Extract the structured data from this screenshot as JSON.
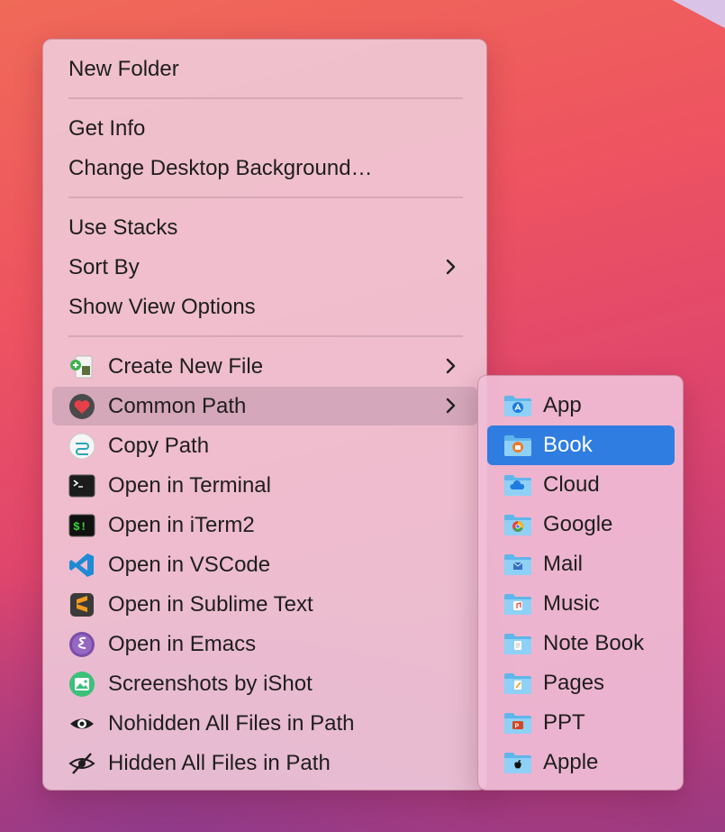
{
  "context_menu": {
    "group1": {
      "new_folder": "New Folder"
    },
    "group2": {
      "get_info": "Get Info",
      "change_bg": "Change Desktop Background…"
    },
    "group3": {
      "use_stacks": "Use Stacks",
      "sort_by": "Sort By",
      "show_view_options": "Show View Options"
    },
    "group4": {
      "create_new_file": "Create New File",
      "common_path": "Common Path",
      "copy_path": "Copy Path",
      "open_terminal": "Open in Terminal",
      "open_iterm2": "Open in iTerm2",
      "open_vscode": "Open in VSCode",
      "open_sublime": "Open in Sublime Text",
      "open_emacs": "Open in Emacs",
      "screenshots_ishot": "Screenshots by iShot",
      "nohidden_files": "Nohidden All Files in Path",
      "hidden_files": "Hidden All Files in Path"
    },
    "highlighted_item": "Common Path"
  },
  "submenu": {
    "items": [
      {
        "label": "App",
        "icon": "app-store-icon"
      },
      {
        "label": "Book",
        "icon": "books-icon"
      },
      {
        "label": "Cloud",
        "icon": "cloud-icon"
      },
      {
        "label": "Google",
        "icon": "chrome-icon"
      },
      {
        "label": "Mail",
        "icon": "mail-icon"
      },
      {
        "label": "Music",
        "icon": "music-icon"
      },
      {
        "label": "Note Book",
        "icon": "notes-icon"
      },
      {
        "label": "Pages",
        "icon": "pages-icon"
      },
      {
        "label": "PPT",
        "icon": "powerpoint-icon"
      },
      {
        "label": "Apple",
        "icon": "apple-icon"
      }
    ],
    "selected": "Book"
  },
  "colors": {
    "selection": "#2f7de1",
    "hover": "#c8a0b4"
  }
}
